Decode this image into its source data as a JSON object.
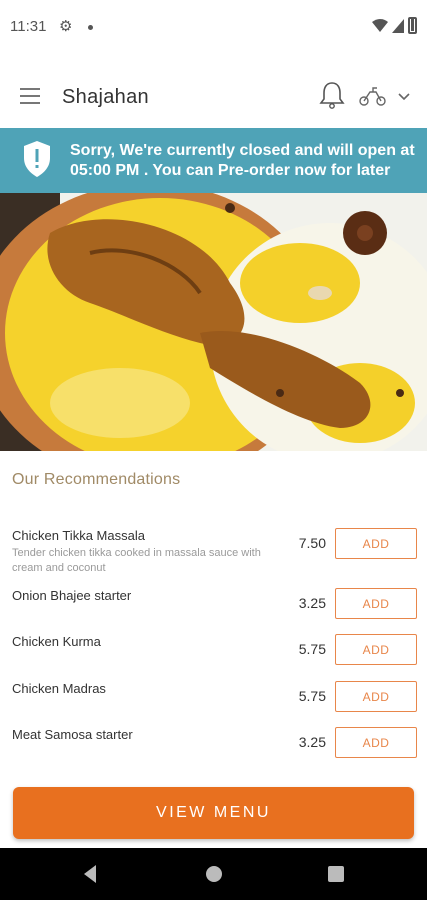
{
  "status_bar": {
    "time": "11:31"
  },
  "header": {
    "title": "Shajahan",
    "menu_icon": "hamburger-icon",
    "notification_icon": "bell-icon",
    "delivery_icon": "scooter-icon"
  },
  "banner": {
    "text": "Sorry, We're currently closed and will open at 05:00 PM . You can Pre-order now for later",
    "color": "#4fa3b7",
    "icon": "shield-icon"
  },
  "recommendations": {
    "title": "Our Recommendations",
    "items": [
      {
        "name": "Chicken Tikka Massala",
        "description": "Tender chicken tikka cooked in massala sauce with cream and coconut",
        "price": "7.50",
        "button": "ADD"
      },
      {
        "name": "Onion Bhajee starter",
        "description": "",
        "price": "3.25",
        "button": "ADD"
      },
      {
        "name": "Chicken Kurma",
        "description": "",
        "price": "5.75",
        "button": "ADD"
      },
      {
        "name": "Chicken Madras",
        "description": "",
        "price": "5.75",
        "button": "ADD"
      },
      {
        "name": "Meat Samosa starter",
        "description": "",
        "price": "3.25",
        "button": "ADD"
      }
    ]
  },
  "footer": {
    "view_menu_label": "VIEW MENU",
    "accent_color": "#e8701f"
  }
}
